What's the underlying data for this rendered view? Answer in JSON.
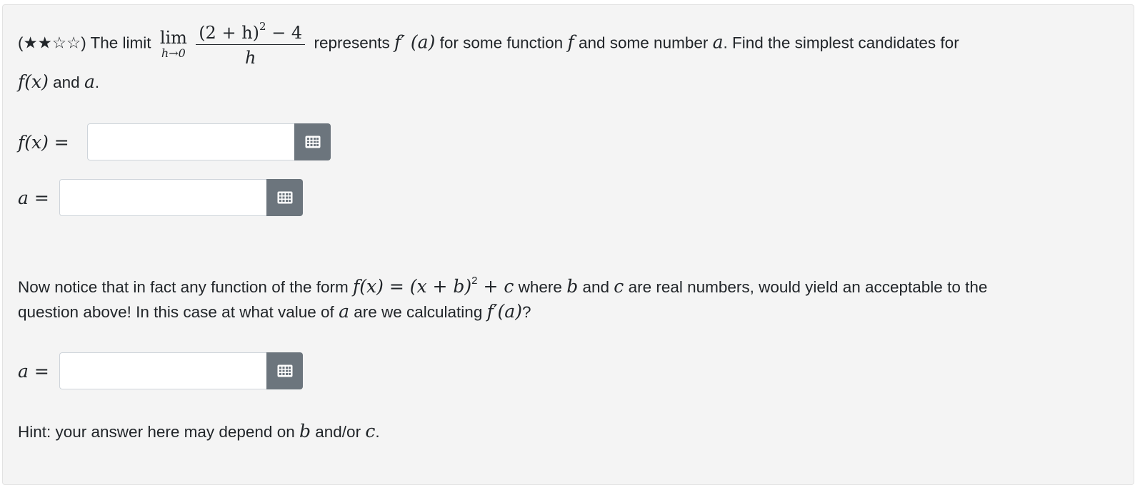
{
  "question": {
    "open_paren": "(",
    "stars_filled": "★★",
    "stars_empty": "☆☆",
    "close_intro": ") The limit",
    "lim": "lim",
    "lim_sub": "h→0",
    "numerator": "(2 + h)",
    "numerator_exp": "2",
    "numerator_tail": " − 4",
    "denominator": "h",
    "text_represents": "represents",
    "fprime_a": "f′ (a)",
    "text_for_some": "for some function",
    "f": "f",
    "text_and_some": "and some number",
    "a": "a",
    "text_find": ". Find the simplest candidates for",
    "fx": "f(x)",
    "text_and": "and",
    "a2": "a",
    "period": "."
  },
  "fields": {
    "fx_label": "f(x)",
    "fx_eq": " =",
    "a_label": "a",
    "a_eq": " =",
    "a2_label": "a",
    "a2_eq": " ="
  },
  "part2": {
    "t1": "Now notice that in fact any function of the form",
    "formula_lhs": "f(x)",
    "formula_eq": " = ",
    "formula_rhs": "(x + b)",
    "formula_exp": "2",
    "formula_tail": " + c",
    "t2": "where",
    "b": "b",
    "t3": "and",
    "c": "c",
    "t4": "are real numbers, would yield an acceptable to the",
    "line2_a": "question above! In this case at what value of",
    "a": "a",
    "line2_b": "are we calculating",
    "fpa": "f′(a)",
    "q": "?"
  },
  "hint": {
    "t1": "Hint: your answer here may depend on",
    "b": "b",
    "t2": "and/or",
    "c": "c",
    "period": "."
  },
  "icons": {
    "math_button": "matrix-keyboard-icon"
  },
  "colors": {
    "panel_bg": "#f4f4f4",
    "button_bg": "#6c757d",
    "text": "#212529"
  }
}
